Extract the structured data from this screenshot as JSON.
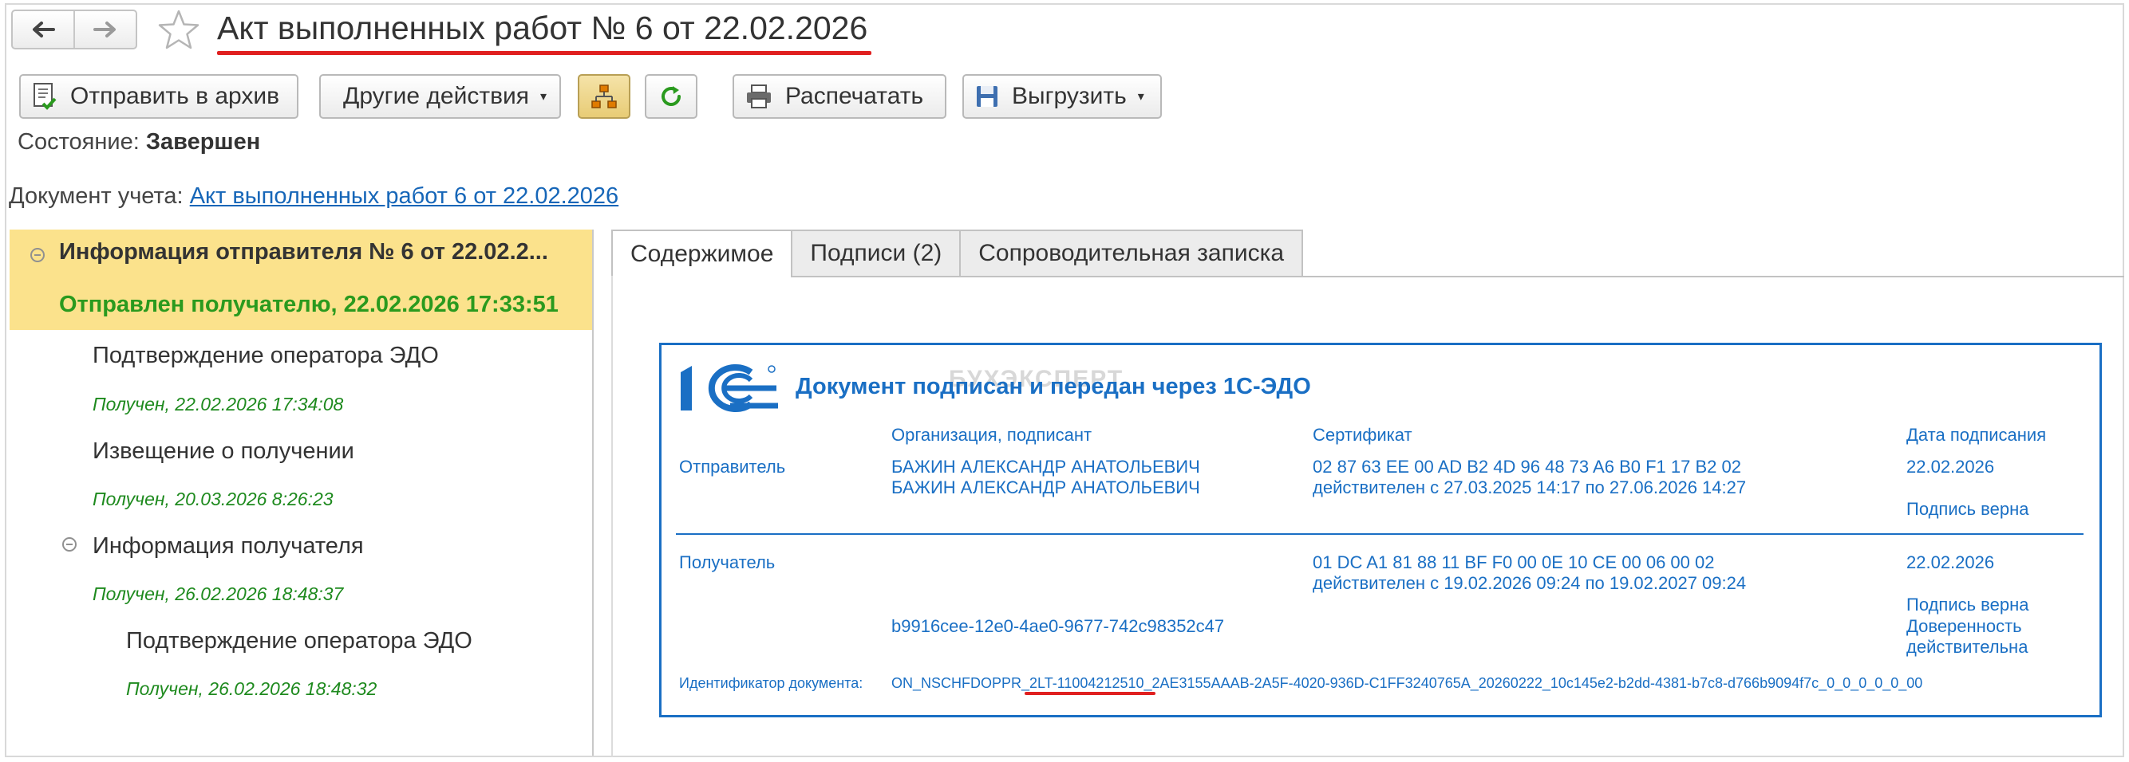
{
  "header": {
    "title": "Акт выполненных работ № 6 от 22.02.2026"
  },
  "toolbar": {
    "archive_label": "Отправить в архив",
    "other_actions_label": "Другие действия",
    "print_label": "Распечатать",
    "export_label": "Выгрузить"
  },
  "state": {
    "label": "Состояние:",
    "value": "Завершен"
  },
  "document": {
    "label": "Документ учета:",
    "link": "Акт выполненных работ 6 от 22.02.2026"
  },
  "tree": {
    "root_title": "Информация отправителя № 6 от 22.02.2...",
    "root_status": "Отправлен получателю, 22.02.2026 17:33:51",
    "items": [
      {
        "title": "Подтверждение оператора ЭДО",
        "status": "Получен, 22.02.2026 17:34:08"
      },
      {
        "title": "Извещение о получении",
        "status": "Получен, 20.03.2026 8:26:23"
      },
      {
        "title": "Информация получателя",
        "status": "Получен, 26.02.2026 18:48:37"
      },
      {
        "title": "Подтверждение оператора ЭДО",
        "status": "Получен, 26.02.2026 18:48:32"
      }
    ]
  },
  "tabs": [
    {
      "label": "Содержимое"
    },
    {
      "label": "Подписи (2)"
    },
    {
      "label": "Сопроводительная записка"
    }
  ],
  "stamp": {
    "heading": "Документ подписан и передан через 1С-ЭДО",
    "watermark": "БУХЭКСПЕРТ",
    "col_org": "Организация, подписант",
    "col_cert": "Сертификат",
    "col_date": "Дата подписания",
    "sender": {
      "role": "Отправитель",
      "org_line1": "БАЖИН АЛЕКСАНДР АНАТОЛЬЕВИЧ",
      "org_line2": "БАЖИН АЛЕКСАНДР АНАТОЛЬЕВИЧ",
      "cert": "02 87 63 EE 00 AD B2 4D 96 48 73 A6 B0 F1 17 B2 02",
      "cert_valid": "действителен с 27.03.2025 14:17 по 27.06.2026 14:27",
      "date": "22.02.2026",
      "sign_status": "Подпись верна"
    },
    "receiver": {
      "role": "Получатель",
      "cert": "01 DC A1 81 88 11 BF F0 00 0E 10 CE 00 06 00 02",
      "cert_valid": "действителен с 19.02.2026 09:24 по 19.02.2027 09:24",
      "date": "22.02.2026",
      "sign_status": "Подпись верна",
      "poa_id": "b9916cee-12e0-4ae0-9677-742c98352c47",
      "poa_status_1": "Доверенность",
      "poa_status_2": "действительна"
    },
    "doc_id_label": "Идентификатор документа:",
    "doc_id": "ON_NSCHFDOPPR_2LT-11004212510_2AE3155AAAB-2A5F-4020-936D-C1FF3240765A_20260222_10c145e2-b2dd-4381-b7c8-d766b9094f7c_0_0_0_0_0_00"
  },
  "colors": {
    "accent_blue": "#1a6fc4",
    "link_blue": "#1666b8",
    "selection_yellow": "#fbe28c",
    "status_green": "#1e8a1e",
    "highlight_red": "#e02020"
  }
}
